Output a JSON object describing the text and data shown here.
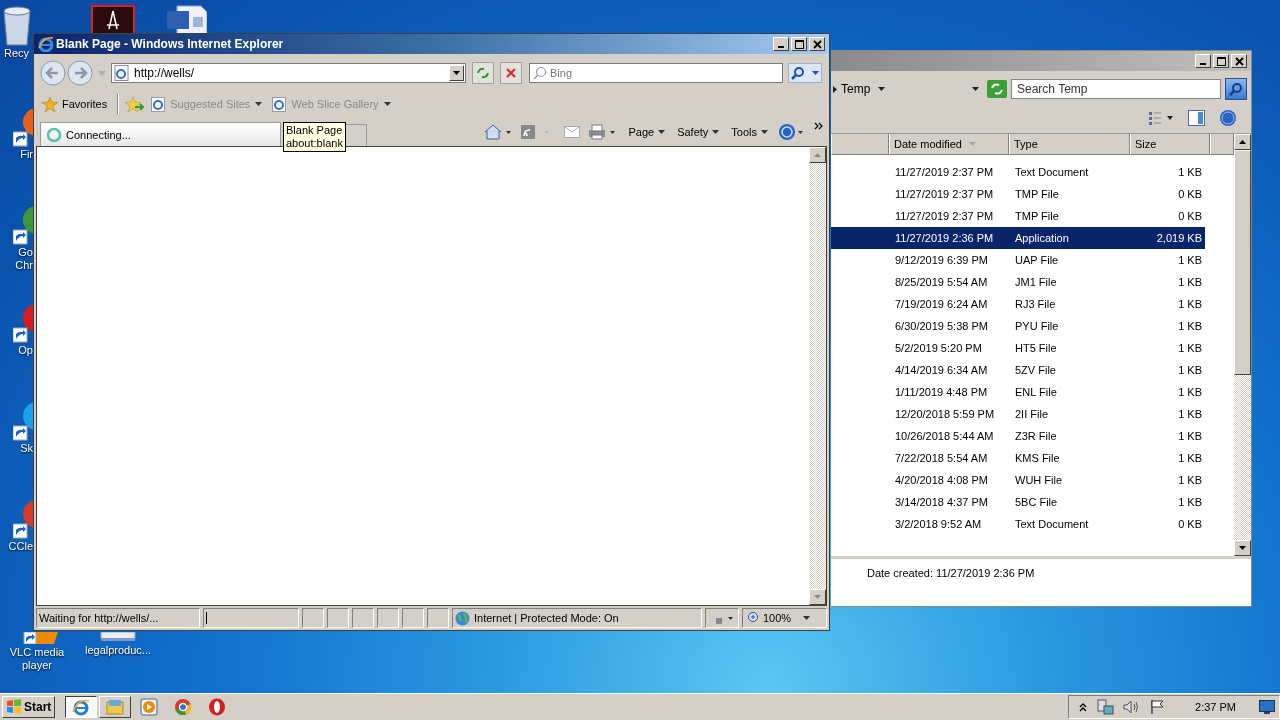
{
  "desktop": {
    "icons": [
      {
        "kind": "recycle",
        "lines": [
          "Recy"
        ]
      },
      {
        "kind": "acrobat"
      },
      {
        "kind": "word"
      },
      {
        "kind": "firefox",
        "lines": [
          "Fir"
        ]
      },
      {
        "kind": "chrome",
        "lines": [
          "Go",
          "Chr"
        ]
      },
      {
        "kind": "opera",
        "lines": [
          "Op"
        ]
      },
      {
        "kind": "skype",
        "lines": [
          "Sk"
        ]
      },
      {
        "kind": "ccleaner",
        "lines": [
          "CCle"
        ]
      },
      {
        "kind": "vlc",
        "lines": [
          "VLC media",
          "player"
        ]
      },
      {
        "kind": "document",
        "lines": [
          "legalproduc..."
        ]
      }
    ]
  },
  "explorer": {
    "address": "Temp",
    "search": {
      "placeholder": "Search Temp"
    },
    "columns": [
      {
        "label": "Date modified",
        "sorted": true
      },
      {
        "label": "Type",
        "sorted": false
      },
      {
        "label": "Size",
        "sorted": false
      }
    ],
    "rows": [
      {
        "date": "11/27/2019 2:37 PM",
        "type": "Text Document",
        "size": "1 KB",
        "selected": false
      },
      {
        "date": "11/27/2019 2:37 PM",
        "type": "TMP File",
        "size": "0 KB",
        "selected": false
      },
      {
        "date": "11/27/2019 2:37 PM",
        "type": "TMP File",
        "size": "0 KB",
        "selected": false
      },
      {
        "date": "11/27/2019 2:36 PM",
        "type": "Application",
        "size": "2,019 KB",
        "selected": true
      },
      {
        "date": "9/12/2019 6:39 PM",
        "type": "UAP File",
        "size": "1 KB",
        "selected": false
      },
      {
        "date": "8/25/2019 5:54 AM",
        "type": "JM1 File",
        "size": "1 KB",
        "selected": false
      },
      {
        "date": "7/19/2019 6:24 AM",
        "type": "RJ3 File",
        "size": "1 KB",
        "selected": false
      },
      {
        "date": "6/30/2019 5:38 PM",
        "type": "PYU File",
        "size": "1 KB",
        "selected": false
      },
      {
        "date": "5/2/2019 5:20 PM",
        "type": "HT5 File",
        "size": "1 KB",
        "selected": false
      },
      {
        "date": "4/14/2019 6:34 AM",
        "type": "5ZV File",
        "size": "1 KB",
        "selected": false
      },
      {
        "date": "1/11/2019 4:48 PM",
        "type": "ENL File",
        "size": "1 KB",
        "selected": false
      },
      {
        "date": "12/20/2018 5:59 PM",
        "type": "2II File",
        "size": "1 KB",
        "selected": false
      },
      {
        "date": "10/26/2018 5:44 AM",
        "type": "Z3R File",
        "size": "1 KB",
        "selected": false
      },
      {
        "date": "7/22/2018 5:54 AM",
        "type": "KMS File",
        "size": "1 KB",
        "selected": false
      },
      {
        "date": "4/20/2018 4:08 PM",
        "type": "WUH File",
        "size": "1 KB",
        "selected": false
      },
      {
        "date": "3/14/2018 4:37 PM",
        "type": "5BC File",
        "size": "1 KB",
        "selected": false
      },
      {
        "date": "3/2/2018 9:52 AM",
        "type": "Text Document",
        "size": "0 KB",
        "selected": false
      }
    ],
    "details": "Date created: 11/27/2019 2:36 PM"
  },
  "ie": {
    "title": "Blank Page - Windows Internet Explorer",
    "address": "http://wells/",
    "search": {
      "placeholder": "Bing"
    },
    "favorites": "Favorites",
    "links": [
      "Suggested Sites",
      "Web Slice Gallery"
    ],
    "tab": "Connecting...",
    "tooltip": [
      "Blank Page",
      "about:blank"
    ],
    "commands": [
      "Page",
      "Safety",
      "Tools"
    ],
    "status": {
      "text": "Waiting for http://wells/...",
      "zone": "Internet | Protected Mode: On",
      "zoom": "100%"
    }
  },
  "taskbar": {
    "start": "Start",
    "apps": [
      {
        "kind": "ie",
        "running": true,
        "active": true
      },
      {
        "kind": "explorer",
        "running": true,
        "active": false
      },
      {
        "kind": "media",
        "running": false,
        "active": false
      },
      {
        "kind": "chrome",
        "running": false,
        "active": false
      },
      {
        "kind": "opera",
        "running": false,
        "active": false
      }
    ],
    "clock": "2:37 PM"
  }
}
